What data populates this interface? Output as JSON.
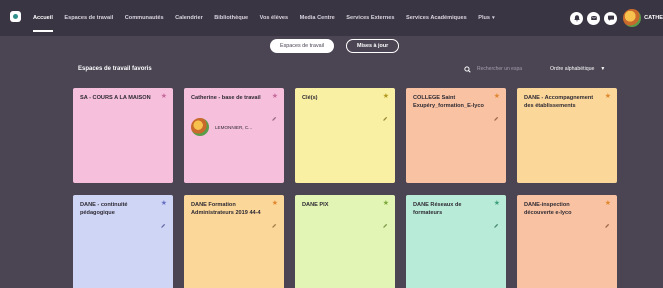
{
  "topbar": {
    "logo_icon": "platform-logo-icon",
    "nav": [
      {
        "label": "Accueil",
        "active": true
      },
      {
        "label": "Espaces de travail"
      },
      {
        "label": "Communautés"
      },
      {
        "label": "Calendrier"
      },
      {
        "label": "Bibliothèque"
      },
      {
        "label": "Vos élèves"
      },
      {
        "label": "Media Centre"
      },
      {
        "label": "Services Externes"
      },
      {
        "label": "Services Académiques"
      },
      {
        "label": "Plus"
      }
    ],
    "right_icons": [
      "alerts-icon",
      "mail-icon",
      "chat-icon"
    ],
    "user_name": "CATHE"
  },
  "actions": {
    "primary_label": "Espaces de travail",
    "secondary_label": "Mises à jour"
  },
  "section": {
    "title": "Espaces de travail favoris",
    "search_placeholder": "Rechercher un espa",
    "sort_label": "Ordre alphabétique"
  },
  "cards": [
    {
      "title": "SA - COURS A LA MAISON",
      "color": "#f6bfdc"
    },
    {
      "title": "Catherine - base de travail",
      "color": "#f6bfdc",
      "member": "LEMONNIER, C..."
    },
    {
      "title": "Clé(s)",
      "color": "#faf0a3"
    },
    {
      "title": "COLLEGE Saint Exupéry_formation_E-lyco",
      "color": "#f9c3a3"
    },
    {
      "title": "DANE - Accompagnement des établissements",
      "color": "#fbd79a"
    },
    {
      "title": "DANE - continuité pédagogique",
      "color": "#cfd5f5"
    },
    {
      "title": "DANE Formation Administrateurs 2019 44-4",
      "color": "#fbd79a"
    },
    {
      "title": "DANE PIX",
      "color": "#e2f5b4"
    },
    {
      "title": "DANE Réseaux de formateurs",
      "color": "#b9ecd8"
    },
    {
      "title": "DANE-inspection découverte e-lyco",
      "color": "#f9c3a3"
    }
  ]
}
